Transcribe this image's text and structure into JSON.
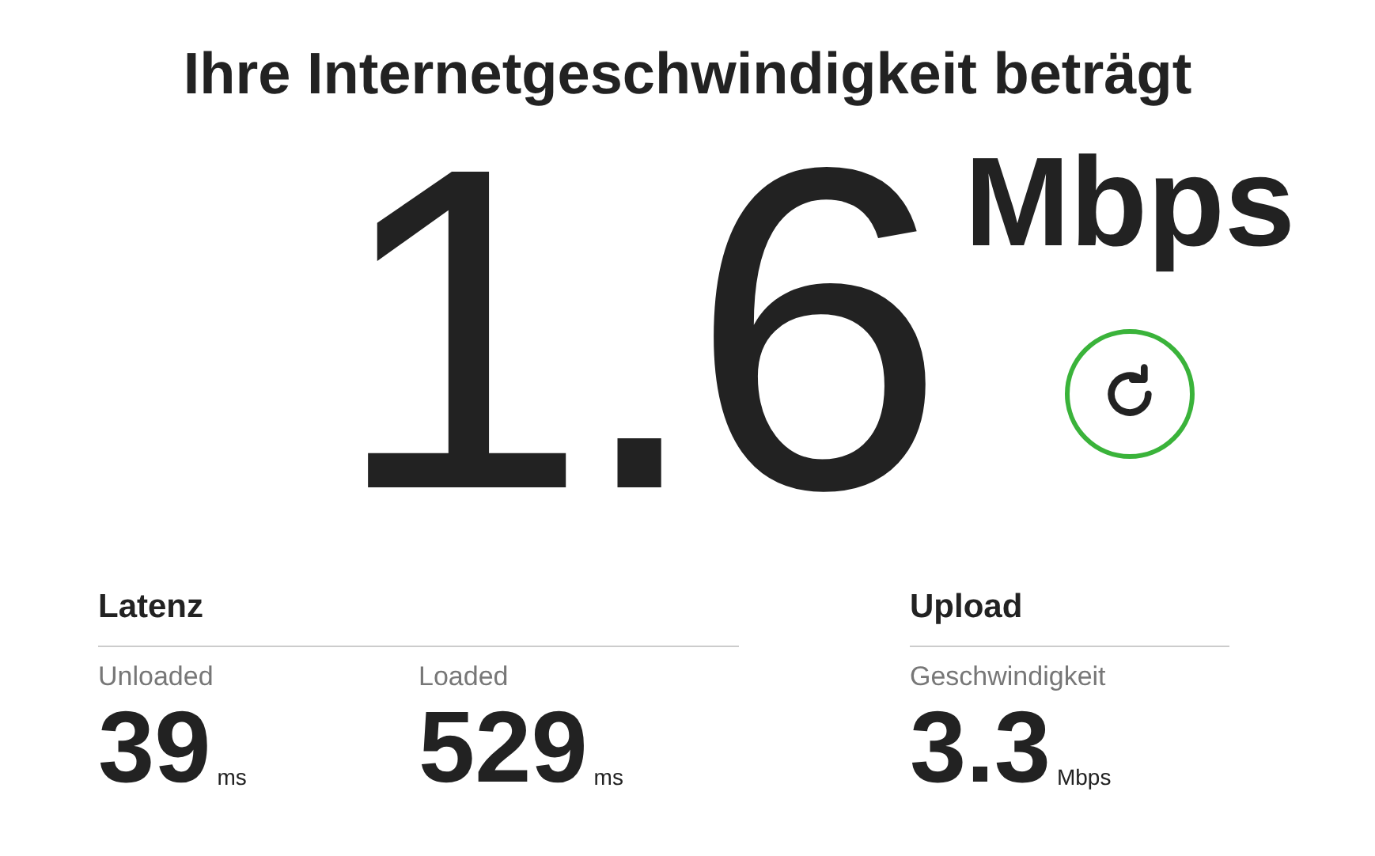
{
  "title": "Ihre Internetgeschwindigkeit beträgt",
  "speed": {
    "value": "1.6",
    "unit": "Mbps"
  },
  "latency": {
    "heading": "Latenz",
    "items": [
      {
        "label": "Unloaded",
        "value": "39",
        "unit": "ms"
      },
      {
        "label": "Loaded",
        "value": "529",
        "unit": "ms"
      }
    ]
  },
  "upload": {
    "heading": "Upload",
    "items": [
      {
        "label": "Geschwindigkeit",
        "value": "3.3",
        "unit": "Mbps"
      }
    ]
  }
}
